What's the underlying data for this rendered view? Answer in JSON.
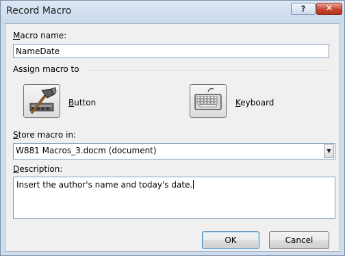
{
  "window": {
    "title": "Record Macro",
    "help_glyph": "?",
    "close_glyph": "✕"
  },
  "macro_name": {
    "label_prefix": "",
    "label_access": "M",
    "label_rest": "acro name:",
    "value": "NameDate"
  },
  "assign": {
    "group_label": "Assign macro to",
    "button_label_access": "B",
    "button_label_rest": "utton",
    "keyboard_label_access": "K",
    "keyboard_label_rest": "eyboard"
  },
  "store": {
    "label_access": "S",
    "label_rest": "tore macro in:",
    "selected": "W881 Macros_3.docm (document)",
    "arrow_glyph": "▼"
  },
  "description": {
    "label_access": "D",
    "label_rest": "escription:",
    "value": "Insert the author's name and today's date."
  },
  "actions": {
    "ok_label": "OK",
    "cancel_label": "Cancel"
  }
}
